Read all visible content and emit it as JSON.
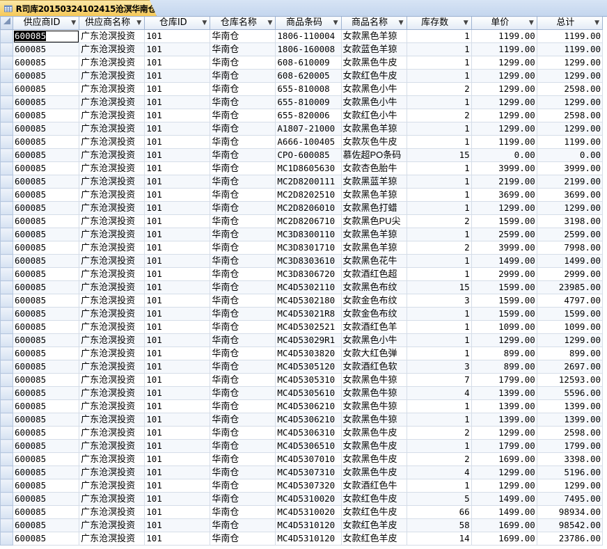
{
  "tab": {
    "title": "R司库20150324102415沧溟华南仓",
    "icon": "table-icon"
  },
  "columns": [
    "供应商ID",
    "供应商名称",
    "仓库ID",
    "仓库名称",
    "商品条码",
    "商品名称",
    "库存数",
    "单价",
    "总计"
  ],
  "rows": [
    [
      "600085",
      "广东沧溟投资",
      "101",
      "华南仓",
      "1806-110004",
      "女款黑色羊猄",
      "1",
      "1199.00",
      "1199.00"
    ],
    [
      "600085",
      "广东沧溟投资",
      "101",
      "华南仓",
      "1806-160008",
      "女款蓝色羊猄",
      "1",
      "1199.00",
      "1199.00"
    ],
    [
      "600085",
      "广东沧溟投资",
      "101",
      "华南仓",
      "608-610009",
      "女款黑色牛皮",
      "1",
      "1299.00",
      "1299.00"
    ],
    [
      "600085",
      "广东沧溟投资",
      "101",
      "华南仓",
      "608-620005",
      "女款红色牛皮",
      "1",
      "1299.00",
      "1299.00"
    ],
    [
      "600085",
      "广东沧溟投资",
      "101",
      "华南仓",
      "655-810008",
      "女款黑色小牛",
      "2",
      "1299.00",
      "2598.00"
    ],
    [
      "600085",
      "广东沧溟投资",
      "101",
      "华南仓",
      "655-810009",
      "女款黑色小牛",
      "1",
      "1299.00",
      "1299.00"
    ],
    [
      "600085",
      "广东沧溟投资",
      "101",
      "华南仓",
      "655-820006",
      "女款红色小牛",
      "2",
      "1299.00",
      "2598.00"
    ],
    [
      "600085",
      "广东沧溟投资",
      "101",
      "华南仓",
      "A1807-21000",
      "女款黑色羊猄",
      "1",
      "1299.00",
      "1299.00"
    ],
    [
      "600085",
      "广东沧溟投资",
      "101",
      "华南仓",
      "A666-100405",
      "女款灰色牛皮",
      "1",
      "1199.00",
      "1199.00"
    ],
    [
      "600085",
      "广东沧溟投资",
      "101",
      "华南仓",
      "CPO-600085",
      "慕佐超PO条码",
      "15",
      "0.00",
      "0.00"
    ],
    [
      "600085",
      "广东沧溟投资",
      "101",
      "华南仓",
      "MC1D8605630",
      "女款杏色胎牛",
      "1",
      "3999.00",
      "3999.00"
    ],
    [
      "600085",
      "广东沧溟投资",
      "101",
      "华南仓",
      "MC2D8200111",
      "女款黑蓝羊猄",
      "1",
      "2199.00",
      "2199.00"
    ],
    [
      "600085",
      "广东沧溟投资",
      "101",
      "华南仓",
      "MC2D8202510",
      "女款黑色羊猄",
      "1",
      "3699.00",
      "3699.00"
    ],
    [
      "600085",
      "广东沧溟投资",
      "101",
      "华南仓",
      "MC2D8206010",
      "女款黑色打蜡",
      "1",
      "1299.00",
      "1299.00"
    ],
    [
      "600085",
      "广东沧溟投资",
      "101",
      "华南仓",
      "MC2D8206710",
      "女款黑色PU尖",
      "2",
      "1599.00",
      "3198.00"
    ],
    [
      "600085",
      "广东沧溟投资",
      "101",
      "华南仓",
      "MC3D8300110",
      "女款黑色羊猄",
      "1",
      "2599.00",
      "2599.00"
    ],
    [
      "600085",
      "广东沧溟投资",
      "101",
      "华南仓",
      "MC3D8301710",
      "女款黑色羊猄",
      "2",
      "3999.00",
      "7998.00"
    ],
    [
      "600085",
      "广东沧溟投资",
      "101",
      "华南仓",
      "MC3D8303610",
      "女款黑色花牛",
      "1",
      "1499.00",
      "1499.00"
    ],
    [
      "600085",
      "广东沧溟投资",
      "101",
      "华南仓",
      "MC3D8306720",
      "女款酒红色超",
      "1",
      "2999.00",
      "2999.00"
    ],
    [
      "600085",
      "广东沧溟投资",
      "101",
      "华南仓",
      "MC4D5302110",
      "女款黑色布纹",
      "15",
      "1599.00",
      "23985.00"
    ],
    [
      "600085",
      "广东沧溟投资",
      "101",
      "华南仓",
      "MC4D5302180",
      "女款金色布纹",
      "3",
      "1599.00",
      "4797.00"
    ],
    [
      "600085",
      "广东沧溟投资",
      "101",
      "华南仓",
      "MC4D53021R8",
      "女款金色布纹",
      "1",
      "1599.00",
      "1599.00"
    ],
    [
      "600085",
      "广东沧溟投资",
      "101",
      "华南仓",
      "MC4D5302521",
      "女款酒红色羊",
      "1",
      "1099.00",
      "1099.00"
    ],
    [
      "600085",
      "广东沧溟投资",
      "101",
      "华南仓",
      "MC4D53029R1",
      "女款黑色小牛",
      "1",
      "1299.00",
      "1299.00"
    ],
    [
      "600085",
      "广东沧溟投资",
      "101",
      "华南仓",
      "MC4D5303820",
      "女款大红色弹",
      "1",
      "899.00",
      "899.00"
    ],
    [
      "600085",
      "广东沧溟投资",
      "101",
      "华南仓",
      "MC4D5305120",
      "女款酒红色软",
      "3",
      "899.00",
      "2697.00"
    ],
    [
      "600085",
      "广东沧溟投资",
      "101",
      "华南仓",
      "MC4D5305310",
      "女款黑色牛猄",
      "7",
      "1799.00",
      "12593.00"
    ],
    [
      "600085",
      "广东沧溟投资",
      "101",
      "华南仓",
      "MC4D5305610",
      "女款黑色牛猄",
      "4",
      "1399.00",
      "5596.00"
    ],
    [
      "600085",
      "广东沧溟投资",
      "101",
      "华南仓",
      "MC4D5306210",
      "女款黑色牛猄",
      "1",
      "1399.00",
      "1399.00"
    ],
    [
      "600085",
      "广东沧溟投资",
      "101",
      "华南仓",
      "MC4D5306210",
      "女款黑色牛猄",
      "1",
      "1399.00",
      "1399.00"
    ],
    [
      "600085",
      "广东沧溟投资",
      "101",
      "华南仓",
      "MC4D5306310",
      "女款黑色牛皮",
      "2",
      "1299.00",
      "2598.00"
    ],
    [
      "600085",
      "广东沧溟投资",
      "101",
      "华南仓",
      "MC4D5306510",
      "女款黑色牛皮",
      "1",
      "1799.00",
      "1799.00"
    ],
    [
      "600085",
      "广东沧溟投资",
      "101",
      "华南仓",
      "MC4D5307010",
      "女款黑色牛皮",
      "2",
      "1699.00",
      "3398.00"
    ],
    [
      "600085",
      "广东沧溟投资",
      "101",
      "华南仓",
      "MC4D5307310",
      "女款黑色牛皮",
      "4",
      "1299.00",
      "5196.00"
    ],
    [
      "600085",
      "广东沧溟投资",
      "101",
      "华南仓",
      "MC4D5307320",
      "女款酒红色牛",
      "1",
      "1299.00",
      "1299.00"
    ],
    [
      "600085",
      "广东沧溟投资",
      "101",
      "华南仓",
      "MC4D5310020",
      "女款红色牛皮",
      "5",
      "1499.00",
      "7495.00"
    ],
    [
      "600085",
      "广东沧溟投资",
      "101",
      "华南仓",
      "MC4D5310020",
      "女款红色牛皮",
      "66",
      "1499.00",
      "98934.00"
    ],
    [
      "600085",
      "广东沧溟投资",
      "101",
      "华南仓",
      "MC4D5310120",
      "女款红色羊皮",
      "58",
      "1699.00",
      "98542.00"
    ],
    [
      "600085",
      "广东沧溟投资",
      "101",
      "华南仓",
      "MC4D5310120",
      "女款红色羊皮",
      "14",
      "1699.00",
      "23786.00"
    ]
  ]
}
